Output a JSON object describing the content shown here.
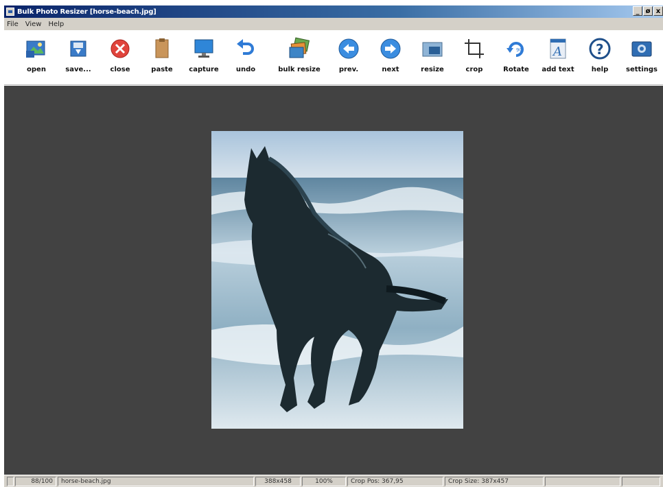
{
  "window": {
    "title": "Bulk Photo Resizer [horse-beach.jpg]",
    "controls": [
      "_",
      "ø",
      "x"
    ]
  },
  "menu": [
    "File",
    "View",
    "Help"
  ],
  "toolbar": [
    {
      "label": "open",
      "icon": "open-icon"
    },
    {
      "label": "save...",
      "icon": "save-icon"
    },
    {
      "label": "close",
      "icon": "close-icon"
    },
    {
      "label": "paste",
      "icon": "paste-icon"
    },
    {
      "label": "capture",
      "icon": "capture-icon"
    },
    {
      "label": "undo",
      "icon": "undo-icon"
    },
    {
      "label": "bulk resize",
      "icon": "bulk-resize-icon"
    },
    {
      "label": "prev.",
      "icon": "prev-icon"
    },
    {
      "label": "next",
      "icon": "next-icon"
    },
    {
      "label": "resize",
      "icon": "resize-icon"
    },
    {
      "label": "crop",
      "icon": "crop-icon"
    },
    {
      "label": "Rotate",
      "icon": "rotate-icon"
    },
    {
      "label": "add text",
      "icon": "add-text-icon"
    },
    {
      "label": "help",
      "icon": "help-icon"
    },
    {
      "label": "settings",
      "icon": "settings-icon"
    }
  ],
  "status": {
    "counter": "88/100",
    "filename": "horse-beach.jpg",
    "dimensions": "388x458",
    "zoom": "100%",
    "crop_pos": "Crop Pos: 367,95",
    "crop_size": "Crop Size: 387x457"
  },
  "colors": {
    "workspace": "#424242",
    "titlebar_start": "#0a246a",
    "chrome": "#d4d0c8"
  }
}
